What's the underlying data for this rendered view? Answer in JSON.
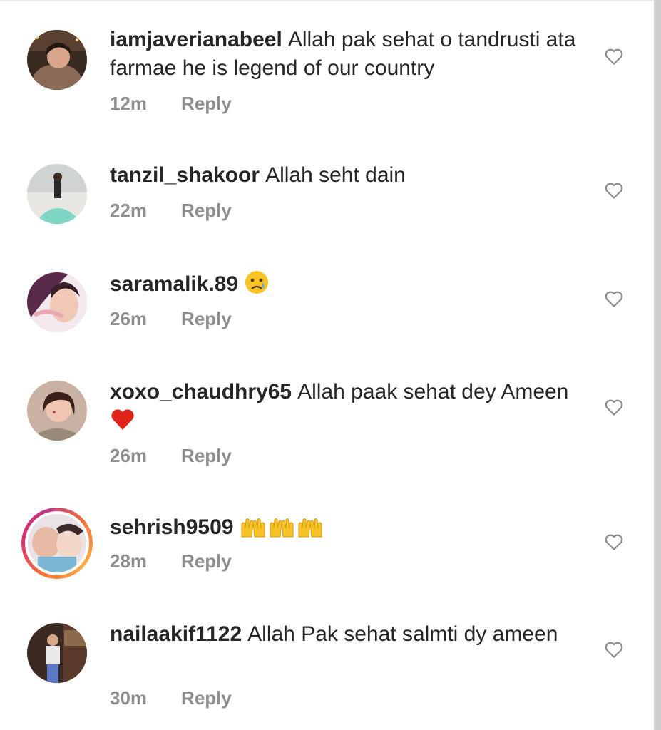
{
  "comments": [
    {
      "username": "iamjaverianabeel",
      "text": "Allah pak sehat o tandrusti ata farmae he is legend of our country",
      "time": "12m",
      "reply_label": "Reply",
      "avatar_color": "#7a5a4a"
    },
    {
      "username": "tanzil_shakoor",
      "text": "Allah seht dain",
      "time": "22m",
      "reply_label": "Reply",
      "avatar_color": "#9fd3c7"
    },
    {
      "username": "saramalik.89",
      "text": "",
      "emoji": "crying-face-emoji",
      "time": "26m",
      "reply_label": "Reply",
      "avatar_color": "#c9708a"
    },
    {
      "username": "xoxo_chaudhry65",
      "text": "Allah paak sehat dey Ameen",
      "emoji": "red-heart-emoji",
      "time": "26m",
      "reply_label": "Reply",
      "avatar_color": "#a87a6a"
    },
    {
      "username": "sehrish9509",
      "text": "",
      "emoji": "raising-hands-emoji x3",
      "time": "28m",
      "reply_label": "Reply",
      "avatar_color": "#d6a9a0",
      "has_story_ring": true
    },
    {
      "username": "nailaakif1122",
      "text": "Allah Pak sehat salmti dy ameen",
      "time": "30m",
      "reply_label": "Reply",
      "avatar_color": "#6b4a3a"
    }
  ],
  "colors": {
    "text": "#262626",
    "meta": "#8e8e8e",
    "heart_outline": "#8e8e8e",
    "emoji_red_heart": "#e0241a",
    "emoji_yellow": "#f7c325"
  }
}
